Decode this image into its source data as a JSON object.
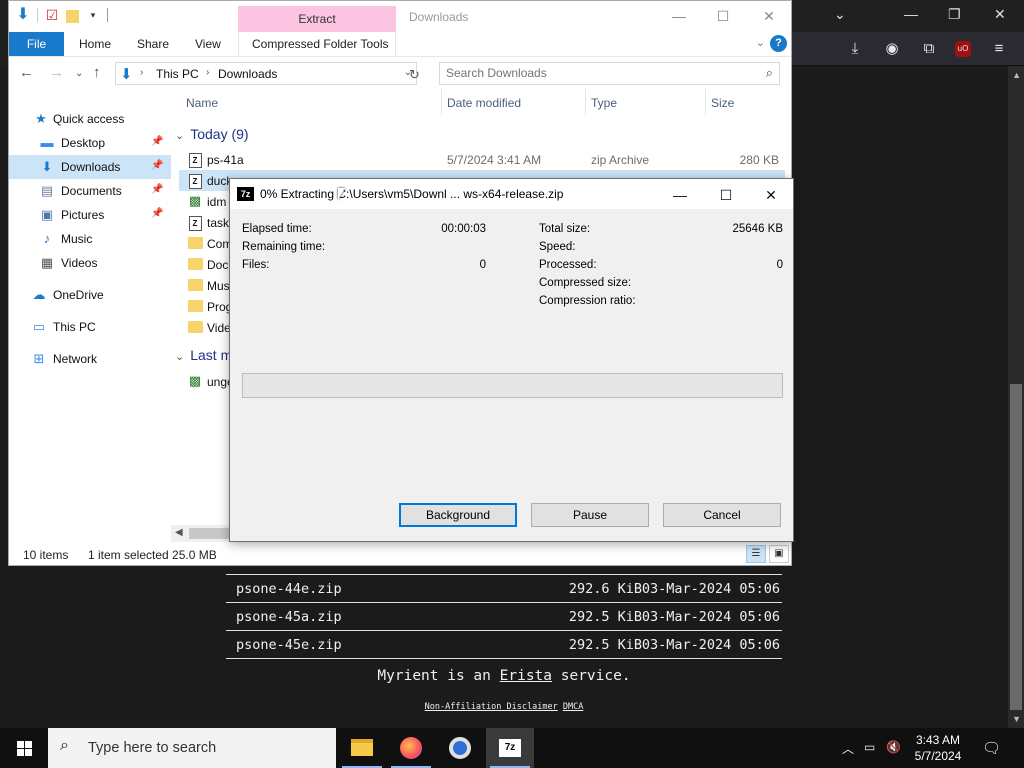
{
  "explorer": {
    "ribbon_contextual_tab": "Extract",
    "window_title": "Downloads",
    "tabs": [
      "File",
      "Home",
      "Share",
      "View",
      "Compressed Folder Tools"
    ],
    "breadcrumb": [
      "This PC",
      "Downloads"
    ],
    "search_placeholder": "Search Downloads",
    "columns": {
      "name": "Name",
      "date": "Date modified",
      "type": "Type",
      "size": "Size"
    },
    "nav": [
      {
        "label": "Quick access",
        "icon": "star-icon"
      },
      {
        "label": "Desktop",
        "icon": "desktop-icon",
        "pinned": true
      },
      {
        "label": "Downloads",
        "icon": "download-arrow-icon",
        "pinned": true,
        "selected": true
      },
      {
        "label": "Documents",
        "icon": "documents-icon",
        "pinned": true
      },
      {
        "label": "Pictures",
        "icon": "pictures-icon",
        "pinned": true
      },
      {
        "label": "Music",
        "icon": "music-note-icon"
      },
      {
        "label": "Videos",
        "icon": "videos-icon"
      },
      {
        "label": "OneDrive",
        "icon": "cloud-icon"
      },
      {
        "label": "This PC",
        "icon": "computer-icon"
      },
      {
        "label": "Network",
        "icon": "network-icon"
      }
    ],
    "groups": {
      "today": "Today (9)",
      "last": "Last m"
    },
    "files": [
      {
        "name": "ps-41a",
        "date": "5/7/2024 3:41 AM",
        "type": "zip Archive",
        "size": "280 KB",
        "icon": "zip-icon"
      },
      {
        "name": "duck",
        "date": "",
        "type": "",
        "size": "",
        "icon": "zip-icon",
        "selected": true
      },
      {
        "name": "idm",
        "date": "",
        "type": "",
        "size": "",
        "icon": "installer-icon"
      },
      {
        "name": "task",
        "date": "",
        "type": "",
        "size": "",
        "icon": "zip-icon"
      },
      {
        "name": "Com",
        "date": "",
        "type": "",
        "size": "",
        "icon": "folder-icon"
      },
      {
        "name": "Doc",
        "date": "",
        "type": "",
        "size": "",
        "icon": "folder-icon"
      },
      {
        "name": "Mus",
        "date": "",
        "type": "",
        "size": "",
        "icon": "folder-icon"
      },
      {
        "name": "Prog",
        "date": "",
        "type": "",
        "size": "",
        "icon": "folder-icon"
      },
      {
        "name": "Vide",
        "date": "",
        "type": "",
        "size": "",
        "icon": "folder-icon"
      }
    ],
    "last_files": [
      {
        "name": "unge",
        "icon": "installer-icon"
      }
    ],
    "status": {
      "items": "10 items",
      "selected": "1 item selected  25.0 MB"
    }
  },
  "sevenzip": {
    "title": "0% Extracting C:\\Users\\vm5\\Downl ... ws-x64-release.zip",
    "title_icon": "7z",
    "left_stats": [
      {
        "label": "Elapsed time:",
        "value": "00:00:03"
      },
      {
        "label": "Remaining time:",
        "value": ""
      },
      {
        "label": "Files:",
        "value": "0"
      }
    ],
    "right_stats": [
      {
        "label": "Total size:",
        "value": "25646 KB"
      },
      {
        "label": "Speed:",
        "value": ""
      },
      {
        "label": "Processed:",
        "value": "0"
      },
      {
        "label": "Compressed size:",
        "value": ""
      },
      {
        "label": "Compression ratio:",
        "value": ""
      }
    ],
    "progress_fraction": 0,
    "buttons": {
      "background": "Background",
      "pause": "Pause",
      "cancel": "Cancel"
    }
  },
  "myrient": {
    "rows": [
      {
        "name": "psone-44e.zip",
        "size": "292.6 KiB",
        "date": "03-Mar-2024 05:06"
      },
      {
        "name": "psone-45a.zip",
        "size": "292.5 KiB",
        "date": "03-Mar-2024 05:06"
      },
      {
        "name": "psone-45e.zip",
        "size": "292.5 KiB",
        "date": "03-Mar-2024 05:06"
      }
    ],
    "footer_pre": "Myrient is an ",
    "footer_link": "Erista",
    "footer_post": " service.",
    "links": [
      "Non-Affiliation Disclaimer",
      "DMCA"
    ]
  },
  "taskbar": {
    "search_placeholder": "Type here to search",
    "time": "3:43 AM",
    "date": "5/7/2024",
    "apps": [
      "file-explorer-icon",
      "firefox-icon",
      "chrome-icon",
      "7zip-icon"
    ]
  },
  "colors": {
    "accent": "#1979ca",
    "extract_tab": "#fbc4e0",
    "selection": "#cce4f7",
    "default_button_border": "#0078d7"
  }
}
